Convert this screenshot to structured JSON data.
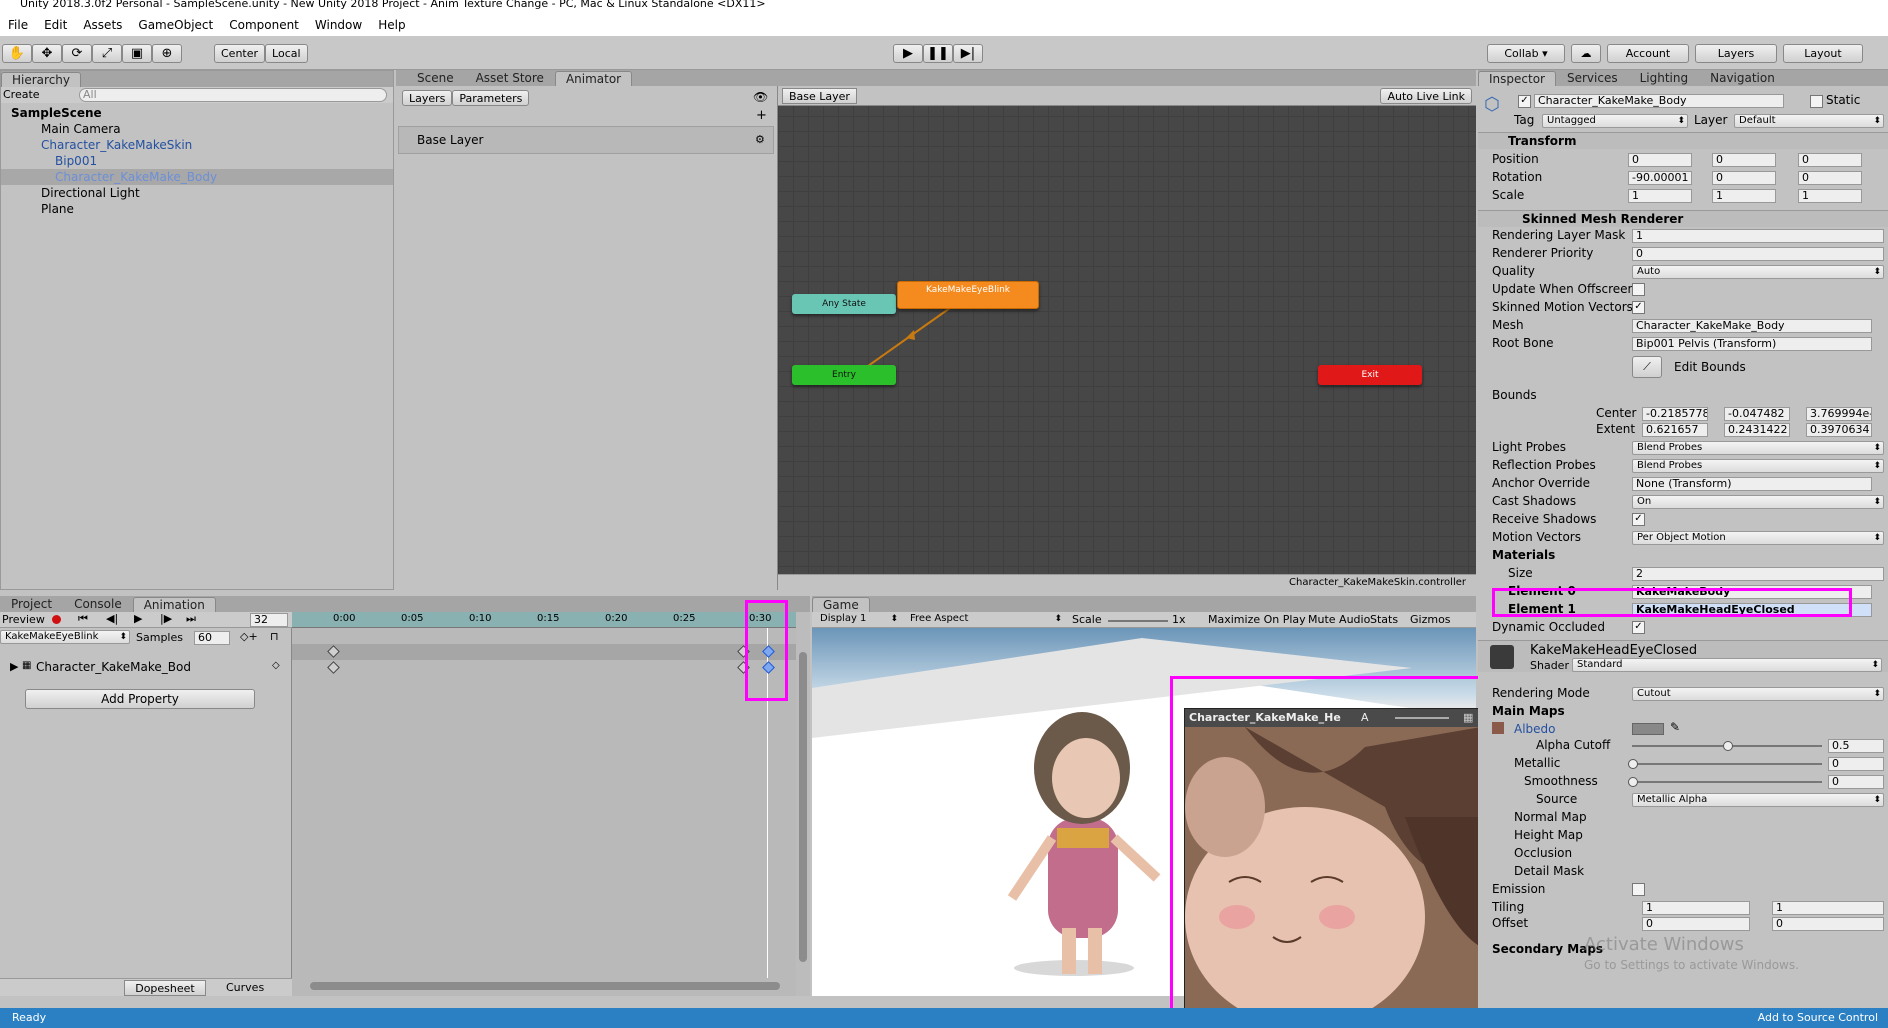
{
  "window": {
    "title": "Unity 2018.3.0f2 Personal - SampleScene.unity - New Unity 2018 Project - Anim Texture Change - PC, Mac & Linux Standalone <DX11>"
  },
  "menu": [
    "File",
    "Edit",
    "Assets",
    "GameObject",
    "Component",
    "Window",
    "Help"
  ],
  "toolbar": {
    "pivot": "Center",
    "space": "Local",
    "collab": "Collab ▾",
    "account": "Account",
    "layers": "Layers",
    "layout": "Layout"
  },
  "hierarchy": {
    "tab": "Hierarchy",
    "create": "Create",
    "search_placeholder": "All",
    "scene": "SampleScene",
    "items": [
      {
        "label": "Main Camera"
      },
      {
        "label": "Character_KakeMakeSkin"
      },
      {
        "label": "Bip001"
      },
      {
        "label": "Character_KakeMake_Body"
      },
      {
        "label": "Directional Light"
      },
      {
        "label": "Plane"
      }
    ]
  },
  "center_tabs": [
    "Scene",
    "Asset Store",
    "Animator"
  ],
  "animator": {
    "left_tabs": [
      "Layers",
      "Parameters"
    ],
    "layer_name": "Base Layer",
    "breadcrumb": "Base Layer",
    "auto_live_link": "Auto Live Link",
    "states": {
      "any": "Any State",
      "blink": "KakeMakeEyeBlink",
      "entry": "Entry",
      "exit": "Exit"
    },
    "controller_file": "Character_KakeMakeSkin.controller"
  },
  "bottom_tabs": [
    "Project",
    "Console",
    "Animation"
  ],
  "animation": {
    "preview": "Preview",
    "frame": "32",
    "clip": "KakeMakeEyeBlink",
    "samples_label": "Samples",
    "samples_value": "60",
    "ruler": [
      "0:00",
      "0:05",
      "0:10",
      "0:15",
      "0:20",
      "0:25",
      "0:30"
    ],
    "property": "Character_KakeMake_Bod",
    "add_property": "Add Property",
    "mode_tabs": [
      "Dopesheet",
      "Curves"
    ]
  },
  "game": {
    "tab": "Game",
    "display": "Display 1",
    "aspect": "Free Aspect",
    "scale_label": "Scale",
    "scale_value": "1x",
    "buttons": [
      "Maximize On Play",
      "Mute Audio",
      "Stats",
      "Gizmos"
    ],
    "texture_preview_title": "Character_KakeMake_He",
    "texture_preview_a": "A"
  },
  "inspector": {
    "tabs": [
      "Inspector",
      "Services",
      "Lighting",
      "Navigation"
    ],
    "object_name": "Character_KakeMake_Body",
    "static_label": "Static",
    "tag_label": "Tag",
    "tag_value": "Untagged",
    "layer_label": "Layer",
    "layer_value": "Default",
    "transform": {
      "title": "Transform",
      "rows": [
        {
          "label": "Position",
          "x": "0",
          "y": "0",
          "z": "0"
        },
        {
          "label": "Rotation",
          "x": "-90.00001",
          "y": "0",
          "z": "0"
        },
        {
          "label": "Scale",
          "x": "1",
          "y": "1",
          "z": "1"
        }
      ]
    },
    "smr": {
      "title": "Skinned Mesh Renderer",
      "rendering_layer_mask": {
        "label": "Rendering Layer Mask",
        "value": "1"
      },
      "renderer_priority": {
        "label": "Renderer Priority",
        "value": "0"
      },
      "quality": {
        "label": "Quality",
        "value": "Auto"
      },
      "update_offscreen": {
        "label": "Update When Offscreen",
        "checked": false
      },
      "skinned_motion": {
        "label": "Skinned Motion Vectors",
        "checked": true
      },
      "mesh": {
        "label": "Mesh",
        "value": "Character_KakeMake_Body"
      },
      "root_bone": {
        "label": "Root Bone",
        "value": "Bip001 Pelvis (Transform)"
      },
      "edit_bounds": "Edit Bounds",
      "bounds_label": "Bounds",
      "center": {
        "label": "Center",
        "x": "-0.2185778",
        "y": "-0.047482",
        "z": "3.769994e-"
      },
      "extent": {
        "label": "Extent",
        "x": "0.621657",
        "y": "0.2431422",
        "z": "0.3970634"
      },
      "light_probes": {
        "label": "Light Probes",
        "value": "Blend Probes"
      },
      "reflection_probes": {
        "label": "Reflection Probes",
        "value": "Blend Probes"
      },
      "anchor_override": {
        "label": "Anchor Override",
        "value": "None (Transform)"
      },
      "cast_shadows": {
        "label": "Cast Shadows",
        "value": "On"
      },
      "receive_shadows": {
        "label": "Receive Shadows",
        "checked": true
      },
      "motion_vectors": {
        "label": "Motion Vectors",
        "value": "Per Object Motion"
      },
      "materials_label": "Materials",
      "size": {
        "label": "Size",
        "value": "2"
      },
      "element0": {
        "label": "Element 0",
        "value": "KakeMakeBody"
      },
      "element1": {
        "label": "Element 1",
        "value": "KakeMakeHeadEyeClosed"
      },
      "dynamic_occluded": {
        "label": "Dynamic Occluded",
        "checked": true
      }
    },
    "material": {
      "name": "KakeMakeHeadEyeClosed",
      "shader_label": "Shader",
      "shader_value": "Standard",
      "rendering_mode": {
        "label": "Rendering Mode",
        "value": "Cutout"
      },
      "main_maps": "Main Maps",
      "albedo": "Albedo",
      "alpha_cutoff": {
        "label": "Alpha Cutoff",
        "value": "0.5",
        "fraction": 0.5
      },
      "metallic": {
        "label": "Metallic",
        "value": "0",
        "fraction": 0
      },
      "smoothness": {
        "label": "Smoothness",
        "value": "0",
        "fraction": 0
      },
      "source": {
        "label": "Source",
        "value": "Metallic Alpha"
      },
      "normal_map": "Normal Map",
      "height_map": "Height Map",
      "occlusion": "Occlusion",
      "detail_mask": "Detail Mask",
      "emission": "Emission",
      "tiling": {
        "label": "Tiling",
        "x": "1",
        "y": "1"
      },
      "offset": {
        "label": "Offset",
        "x": "0",
        "y": "0"
      },
      "secondary_maps": "Secondary Maps"
    },
    "watermark_line1": "Activate Windows",
    "watermark_line2": "Go to Settings to activate Windows."
  },
  "status": {
    "left": "Ready",
    "right": "Add to Source Control"
  }
}
